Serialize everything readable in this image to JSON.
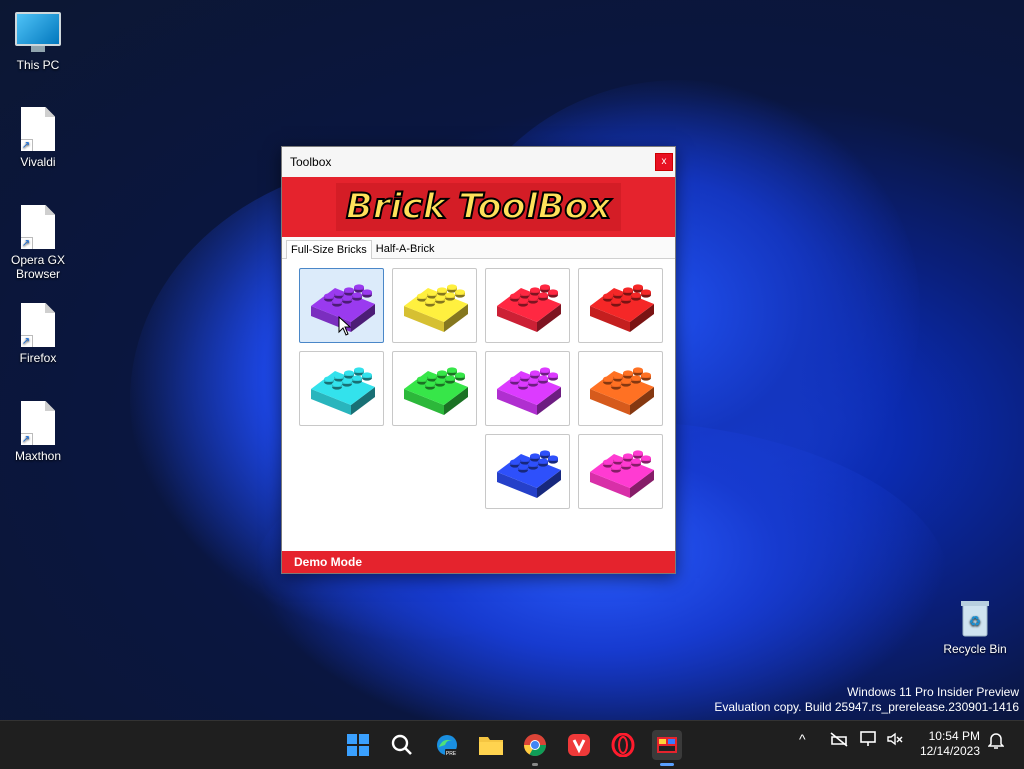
{
  "desktop": {
    "icons": [
      {
        "label": "This PC",
        "icon": "computer-icon"
      },
      {
        "label": "Vivaldi",
        "icon": "file-shortcut-icon"
      },
      {
        "label": "Opera GX Browser",
        "icon": "file-shortcut-icon"
      },
      {
        "label": "Firefox",
        "icon": "file-shortcut-icon"
      },
      {
        "label": "Maxthon",
        "icon": "file-shortcut-icon"
      },
      {
        "label": "Recycle Bin",
        "icon": "recycle-bin-icon"
      }
    ],
    "watermark_line1": "Windows 11 Pro Insider Preview",
    "watermark_line2": "Evaluation copy. Build 25947.rs_prerelease.230901-1416"
  },
  "window": {
    "title": "Toolbox",
    "close_label": "x",
    "banner": "Brick ToolBox",
    "tabs": [
      {
        "label": "Full-Size Bricks",
        "active": true
      },
      {
        "label": "Half-A-Brick",
        "active": false
      }
    ],
    "bricks": [
      {
        "color": "#7b2ebf",
        "name": "purple",
        "selected": true
      },
      {
        "color": "#d6c032",
        "name": "yellow"
      },
      {
        "color": "#cc2035",
        "name": "red"
      },
      {
        "color": "#c41f1f",
        "name": "dark-red"
      },
      {
        "color": "#29b5bd",
        "name": "teal"
      },
      {
        "color": "#2cb83a",
        "name": "green"
      },
      {
        "color": "#b02fd0",
        "name": "magenta"
      },
      {
        "color": "#d65a1c",
        "name": "orange"
      },
      {
        "color": "#2540c9",
        "name": "blue"
      },
      {
        "color": "#d82fa8",
        "name": "pink"
      }
    ],
    "footer": "Demo Mode"
  },
  "taskbar": {
    "apps": [
      "start-icon",
      "search-icon",
      "edge-icon",
      "file-explorer-icon",
      "chrome-icon",
      "vivaldi-icon",
      "opera-icon",
      "brick-toolbox-icon"
    ],
    "clock_time": "10:54 PM",
    "clock_date": "12/14/2023"
  }
}
